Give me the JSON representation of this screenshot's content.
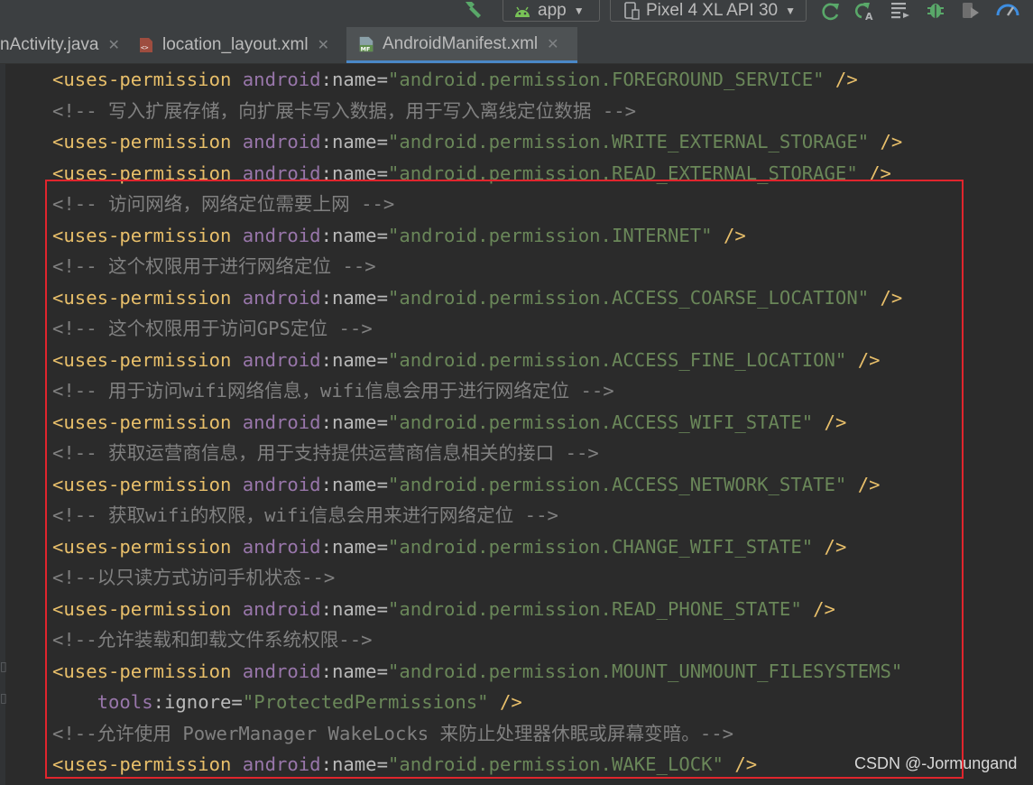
{
  "toolbar": {
    "config_label": "app",
    "device_label": "Pixel 4 XL API 30",
    "icons": [
      "hammer-icon",
      "android-icon",
      "device-icon",
      "apply-changes-icon",
      "apply-code-changes-icon",
      "logcat-icon",
      "debug-icon",
      "attach-debugger-icon",
      "profiler-icon"
    ]
  },
  "tabs": [
    {
      "label": "nActivity.java",
      "active": false
    },
    {
      "label": "location_layout.xml",
      "active": false
    },
    {
      "label": "AndroidManifest.xml",
      "active": true
    }
  ],
  "code": {
    "lines": [
      [
        [
          "tag",
          "<uses-permission "
        ],
        [
          "ns",
          "android"
        ],
        [
          "attr",
          ":name="
        ],
        [
          "str",
          "\"android.permission.FOREGROUND_SERVICE\""
        ],
        [
          "tag",
          " />"
        ]
      ],
      [
        [
          "cmt",
          "<!-- 写入扩展存储，向扩展卡写入数据，用于写入离线定位数据 -->"
        ]
      ],
      [
        [
          "tag",
          "<uses-permission "
        ],
        [
          "ns",
          "android"
        ],
        [
          "attr",
          ":name="
        ],
        [
          "str",
          "\"android.permission.WRITE_EXTERNAL_STORAGE\""
        ],
        [
          "tag",
          " />"
        ]
      ],
      [
        [
          "tag",
          "<uses-permission "
        ],
        [
          "ns",
          "android"
        ],
        [
          "attr",
          ":name="
        ],
        [
          "str",
          "\"android.permission.READ_EXTERNAL_STORAGE\""
        ],
        [
          "tag",
          " />"
        ]
      ],
      [
        [
          "cmt",
          "<!-- 访问网络，网络定位需要上网 -->"
        ]
      ],
      [
        [
          "tag",
          "<uses-permission "
        ],
        [
          "ns",
          "android"
        ],
        [
          "attr",
          ":name="
        ],
        [
          "str",
          "\"android.permission.INTERNET\""
        ],
        [
          "tag",
          " />"
        ]
      ],
      [
        [
          "cmt",
          "<!-- 这个权限用于进行网络定位 -->"
        ]
      ],
      [
        [
          "tag",
          "<uses-permission "
        ],
        [
          "ns",
          "android"
        ],
        [
          "attr",
          ":name="
        ],
        [
          "str",
          "\"android.permission.ACCESS_COARSE_LOCATION\""
        ],
        [
          "tag",
          " />"
        ]
      ],
      [
        [
          "cmt",
          "<!-- 这个权限用于访问GPS定位 -->"
        ]
      ],
      [
        [
          "tag",
          "<uses-permission "
        ],
        [
          "ns",
          "android"
        ],
        [
          "attr",
          ":name="
        ],
        [
          "str",
          "\"android.permission.ACCESS_FINE_LOCATION\""
        ],
        [
          "tag",
          " />"
        ]
      ],
      [
        [
          "cmt",
          "<!-- 用于访问wifi网络信息，wifi信息会用于进行网络定位 -->"
        ]
      ],
      [
        [
          "tag",
          "<uses-permission "
        ],
        [
          "ns",
          "android"
        ],
        [
          "attr",
          ":name="
        ],
        [
          "str",
          "\"android.permission.ACCESS_WIFI_STATE\""
        ],
        [
          "tag",
          " />"
        ]
      ],
      [
        [
          "cmt",
          "<!-- 获取运营商信息，用于支持提供运营商信息相关的接口 -->"
        ]
      ],
      [
        [
          "tag",
          "<uses-permission "
        ],
        [
          "ns",
          "android"
        ],
        [
          "attr",
          ":name="
        ],
        [
          "str",
          "\"android.permission.ACCESS_NETWORK_STATE\""
        ],
        [
          "tag",
          " />"
        ]
      ],
      [
        [
          "cmt",
          "<!-- 获取wifi的权限，wifi信息会用来进行网络定位 -->"
        ]
      ],
      [
        [
          "tag",
          "<uses-permission "
        ],
        [
          "ns",
          "android"
        ],
        [
          "attr",
          ":name="
        ],
        [
          "str",
          "\"android.permission.CHANGE_WIFI_STATE\""
        ],
        [
          "tag",
          " />"
        ]
      ],
      [
        [
          "cmt",
          "<!--以只读方式访问手机状态-->"
        ]
      ],
      [
        [
          "tag",
          "<uses-permission "
        ],
        [
          "ns",
          "android"
        ],
        [
          "attr",
          ":name="
        ],
        [
          "str",
          "\"android.permission.READ_PHONE_STATE\""
        ],
        [
          "tag",
          " />"
        ]
      ],
      [
        [
          "cmt",
          "<!--允许装载和卸载文件系统权限-->"
        ]
      ],
      [
        [
          "tag",
          "<uses-permission "
        ],
        [
          "ns",
          "android"
        ],
        [
          "attr",
          ":name="
        ],
        [
          "str",
          "\"android.permission.MOUNT_UNMOUNT_FILESYSTEMS\""
        ]
      ],
      [
        [
          "attr",
          "    "
        ],
        [
          "ns",
          "tools"
        ],
        [
          "attr",
          ":ignore="
        ],
        [
          "str",
          "\"ProtectedPermissions\""
        ],
        [
          "tag",
          " />"
        ]
      ],
      [
        [
          "cmt",
          "<!--允许使用 PowerManager WakeLocks 来防止处理器休眠或屏幕变暗。-->"
        ]
      ],
      [
        [
          "tag",
          "<uses-permission "
        ],
        [
          "ns",
          "android"
        ],
        [
          "attr",
          ":name="
        ],
        [
          "str",
          "\"android.permission.WAKE_LOCK\""
        ],
        [
          "tag",
          " />"
        ]
      ]
    ]
  },
  "watermark": "CSDN @-Jormungand"
}
